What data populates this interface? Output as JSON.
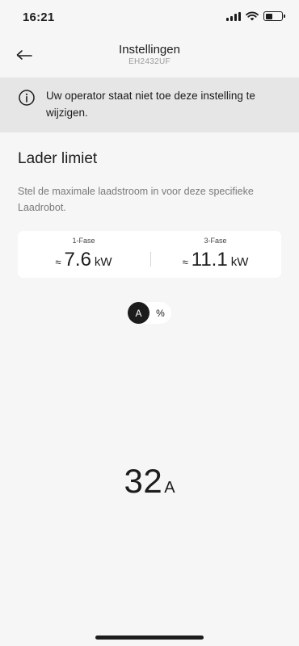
{
  "status_bar": {
    "time": "16:21",
    "battery_level": 0.45
  },
  "header": {
    "title": "Instellingen",
    "subtitle": "EH2432UF",
    "back_icon": "arrow-left-icon"
  },
  "notice": {
    "icon": "info-icon",
    "text": "Uw operator staat niet toe deze instelling te wijzigen."
  },
  "section": {
    "title": "Lader limiet",
    "description": "Stel de maximale laadstroom in voor deze specifieke Laadrobot."
  },
  "power": {
    "items": [
      {
        "label": "1-Fase",
        "approx": "≈",
        "value": "7.6",
        "unit": "kW"
      },
      {
        "label": "3-Fase",
        "approx": "≈",
        "value": "11.1",
        "unit": "kW"
      }
    ]
  },
  "unit_toggle": {
    "options": [
      "A",
      "%"
    ],
    "selected": "A"
  },
  "current": {
    "value": "32",
    "unit": "A"
  },
  "colors": {
    "background": "#f6f6f6",
    "notice_background": "#e6e6e6",
    "text_primary": "#1c1c1c",
    "text_secondary": "#7a7a7a",
    "card": "#ffffff"
  }
}
